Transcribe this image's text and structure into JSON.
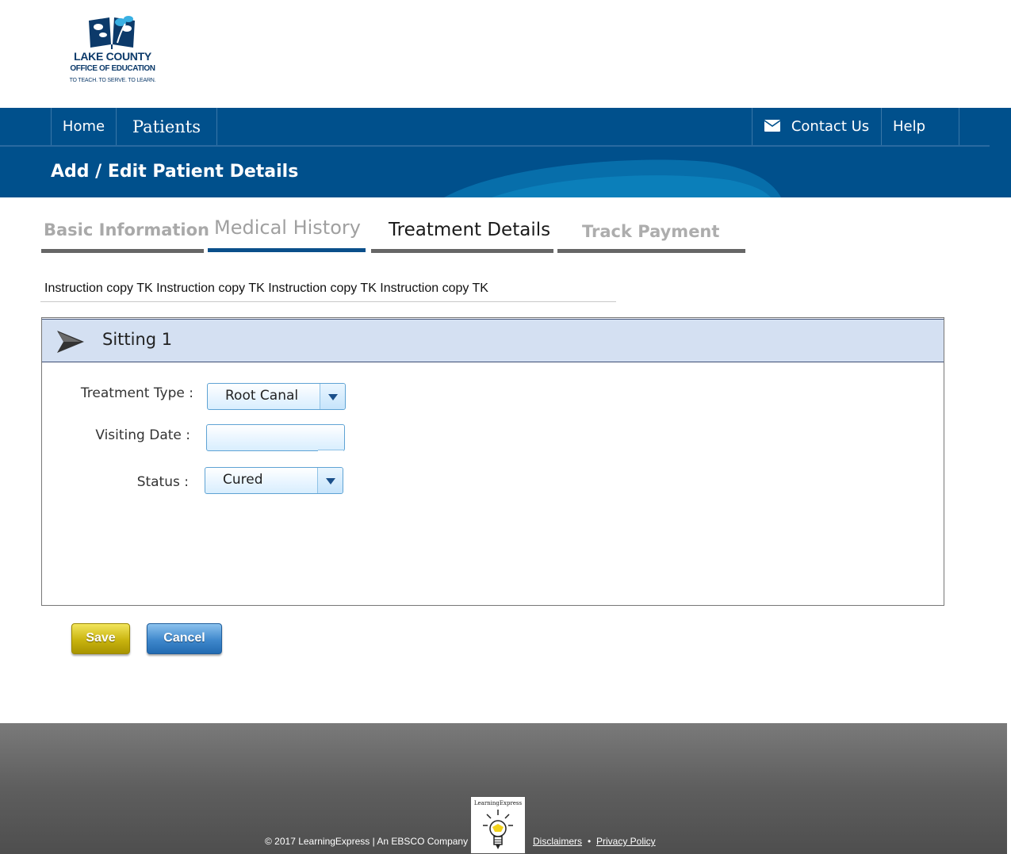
{
  "logo": {
    "name": "LAKE COUNTY",
    "subtitle": "OFFICE OF EDUCATION",
    "tagline": "TO TEACH. TO SERVE. TO LEARN."
  },
  "nav": {
    "home": "Home",
    "patients": "Patients",
    "contact": "Contact Us",
    "help": "Help"
  },
  "page_title": "Add / Edit Patient Details",
  "tabs": [
    {
      "label": "Basic Information",
      "bar_color": "#666666"
    },
    {
      "label": "Medical History",
      "bar_color": "#0a4f8a"
    },
    {
      "label": "Treatment Details",
      "bar_color": "#666666"
    },
    {
      "label": "Track Payment",
      "bar_color": "#666666"
    }
  ],
  "instruction": "Instruction copy TK Instruction copy TK Instruction copy TK Instruction copy TK",
  "sitting": {
    "title": "Sitting 1",
    "fields": {
      "treatment_type_label": "Treatment Type :",
      "treatment_type_value": "Root Canal",
      "visiting_date_label": "Visiting Date :",
      "visiting_date_value": "",
      "status_label": "Status :",
      "status_value": "Cured"
    }
  },
  "buttons": {
    "save": "Save",
    "cancel": "Cancel"
  },
  "footer": {
    "copyright": "© 2017 LearningExpress  |  An EBSCO Company",
    "logo_text": "LearningExpress",
    "disclaimers": "Disclaimers",
    "separator": "•",
    "privacy": "Privacy Policy"
  },
  "colors": {
    "primary_blue": "#00508c",
    "panel_header": "#d4e0f2",
    "save_button": "#c9b40f",
    "cancel_button": "#3f88cc",
    "footer": "#5e5e5e"
  }
}
